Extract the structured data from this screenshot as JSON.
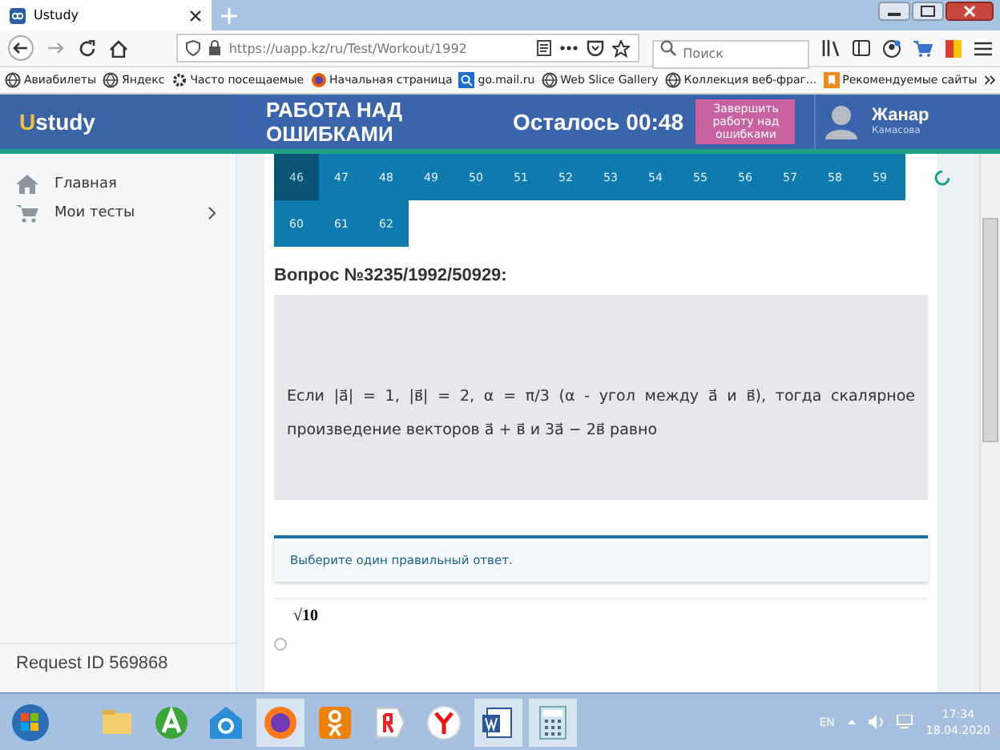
{
  "browser": {
    "tab_title": "Ustudy",
    "url": "https://uapp.kz/ru/Test/Workout/1992",
    "search_placeholder": "Поиск",
    "bookmarks": [
      "Авиабилеты",
      "Яндекс",
      "Часто посещаемые",
      "Начальная страница",
      "go.mail.ru",
      "Web Slice Gallery",
      "Коллекция веб-фраг...",
      "Рекомендуемые сайты"
    ]
  },
  "app": {
    "logo": "Ustudy",
    "title": "РАБОТА НАД ОШИБКАМИ",
    "timer": "Осталось 00:48",
    "finish_button": "Завершить работу над ошибками",
    "user": {
      "name": "Жанар",
      "surname": "Камасова"
    }
  },
  "sidebar": {
    "items": [
      {
        "label": "Главная",
        "has_submenu": false
      },
      {
        "label": "Мои тесты",
        "has_submenu": true
      }
    ],
    "request_id": "Request ID 569868"
  },
  "question_numbers": [
    {
      "number": "46",
      "selected": true
    },
    {
      "number": "47",
      "selected": false
    },
    {
      "number": "48",
      "selected": false
    },
    {
      "number": "49",
      "selected": false
    },
    {
      "number": "50",
      "selected": false
    },
    {
      "number": "51",
      "selected": false
    },
    {
      "number": "52",
      "selected": false
    },
    {
      "number": "53",
      "selected": false
    },
    {
      "number": "54",
      "selected": false
    },
    {
      "number": "55",
      "selected": false
    },
    {
      "number": "56",
      "selected": false
    },
    {
      "number": "57",
      "selected": false
    },
    {
      "number": "58",
      "selected": false
    },
    {
      "number": "59",
      "selected": false
    },
    {
      "number": "60",
      "selected": false
    },
    {
      "number": "61",
      "selected": false
    },
    {
      "number": "62",
      "selected": false
    }
  ],
  "question": {
    "title": "Вопрос №3235/1992/50929:",
    "text": "Если |a⃗| = 1,  |в⃗| = 2,  α = π/3  (α - угол между a⃗ и в⃗), тогда скалярное произведение векторов a⃗ + в⃗  и  3a⃗ − 2в⃗ равно",
    "instruction": "Выберите один правильный ответ.",
    "answers": [
      {
        "text": "√10",
        "selected": false
      }
    ]
  },
  "taskbar": {
    "language": "EN",
    "time": "17:34",
    "date": "18.04.2020"
  }
}
